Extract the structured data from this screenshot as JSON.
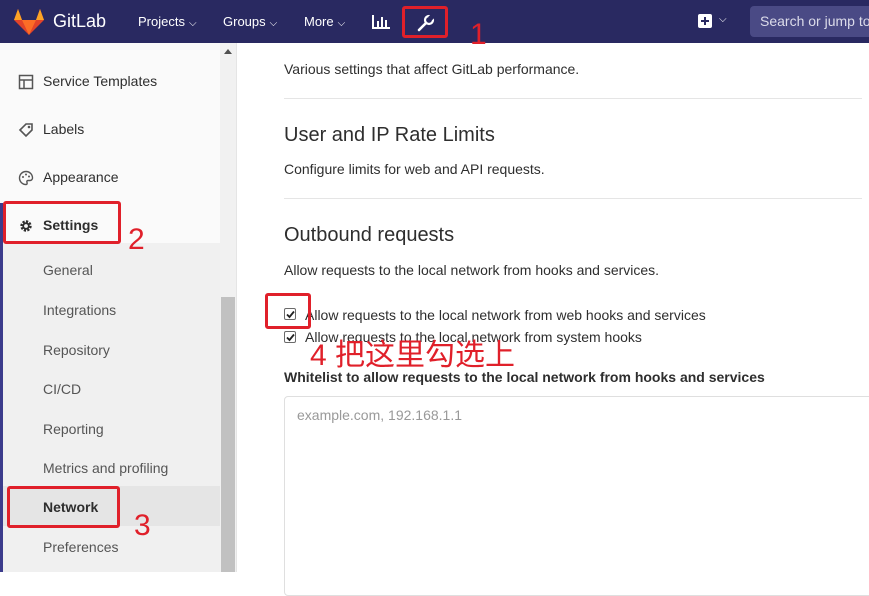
{
  "navbar": {
    "brand": "GitLab",
    "links": [
      {
        "label": "Projects"
      },
      {
        "label": "Groups"
      },
      {
        "label": "More"
      }
    ],
    "chevron": "⌵",
    "search_placeholder": "Search or jump to…",
    "icons": [
      "gitlab-logo",
      "activity-chart-icon",
      "admin-wrench-icon",
      "new-plus-icon"
    ]
  },
  "sidebar": {
    "items": [
      {
        "label": "Service Templates",
        "icon": "template-icon"
      },
      {
        "label": "Labels",
        "icon": "label-icon"
      },
      {
        "label": "Appearance",
        "icon": "palette-icon"
      },
      {
        "label": "Settings",
        "icon": "gear-icon"
      }
    ],
    "subitems": [
      {
        "label": "General"
      },
      {
        "label": "Integrations"
      },
      {
        "label": "Repository"
      },
      {
        "label": "CI/CD"
      },
      {
        "label": "Reporting"
      },
      {
        "label": "Metrics and profiling"
      },
      {
        "label": "Network"
      },
      {
        "label": "Preferences"
      }
    ]
  },
  "main": {
    "top_desc": "Various settings that affect GitLab performance.",
    "rate_limits": {
      "title": "User and IP Rate Limits",
      "desc": "Configure limits for web and API requests."
    },
    "outbound": {
      "title": "Outbound requests",
      "desc": "Allow requests to the local network from hooks and services.",
      "checkbox1": "Allow requests to the local network from web hooks and services",
      "checkbox2": "Allow requests to the local network from system hooks",
      "checkbox1_checked": true,
      "checkbox2_checked": true,
      "whitelist_label": "Whitelist to allow requests to the local network from hooks and services",
      "whitelist_placeholder": "example.com, 192.168.1.1"
    }
  },
  "annotations": {
    "n1": "1",
    "n2": "2",
    "n3": "3",
    "n4": "4 把这里勾选上"
  },
  "colors": {
    "navbar": "#292961",
    "annotation": "#e0202a"
  }
}
